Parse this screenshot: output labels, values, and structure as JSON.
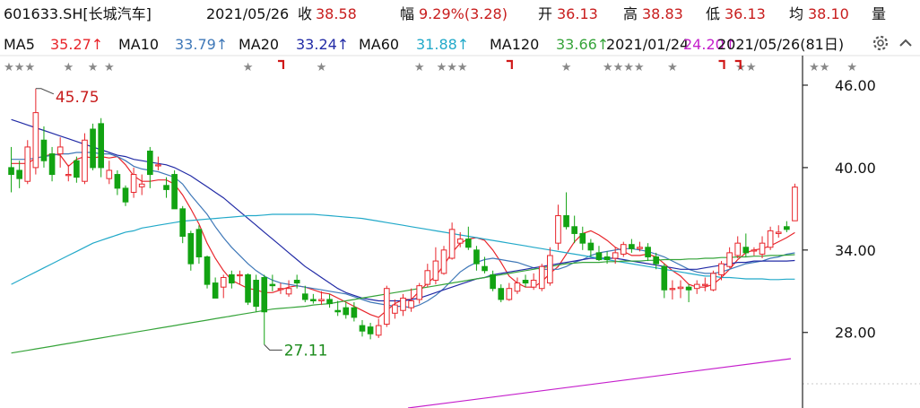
{
  "header": {
    "code_name": "601633.SH[长城汽车]",
    "date": "2021/05/26",
    "close_label": "收",
    "close": "38.58",
    "change_label": "幅",
    "change": "9.29%(3.28)",
    "open_label": "开",
    "open": "36.13",
    "high_label": "高",
    "high": "38.83",
    "low_label": "低",
    "low": "36.13",
    "avg_label": "均",
    "avg": "38.10",
    "volume_label": "量"
  },
  "ma_bar": {
    "items": [
      {
        "label": "MA5",
        "value": "35.27↑",
        "color": "#e8252b"
      },
      {
        "label": "MA10",
        "value": "33.79↑",
        "color": "#3f78b8"
      },
      {
        "label": "MA20",
        "value": "33.24↑",
        "color": "#222ba6"
      },
      {
        "label": "MA60",
        "value": "31.88↑",
        "color": "#22a9c9"
      },
      {
        "label": "MA120",
        "value": "33.66↑",
        "color": "#36a43a"
      },
      {
        "label": "",
        "value": "24.20↑",
        "color": "#c51fcc"
      }
    ],
    "overlap_text": "2021/01/24",
    "range_text": "2021/05/26(81日)",
    "settings_icon": "gear-icon",
    "collapse_icon": "chevron-up-icon"
  },
  "colors": {
    "up": "#e8252b",
    "down": "#12a312",
    "axis": "#222222",
    "grid": "#dddddd"
  },
  "chart_data": {
    "type": "candlestick",
    "ylim": [
      22.5,
      47.5
    ],
    "yticks": [
      "46.00",
      "40.00",
      "34.00",
      "28.00"
    ],
    "ytick_values": [
      46,
      40,
      34,
      28
    ],
    "annotations": [
      {
        "text": "45.75",
        "index": 3,
        "value": 45.75
      },
      {
        "text": "27.11",
        "index": 31,
        "value": 27.11
      }
    ],
    "candles": [
      [
        40,
        39.5,
        41.5,
        38.2
      ],
      [
        39.8,
        39.2,
        40.5,
        38.5
      ],
      [
        39,
        41.5,
        42,
        38.8
      ],
      [
        40,
        44,
        45.75,
        39.5
      ],
      [
        42,
        40.5,
        43,
        40
      ],
      [
        41,
        39.5,
        41.5,
        39
      ],
      [
        41,
        41.5,
        42.2,
        40
      ],
      [
        39.5,
        39.5,
        40.2,
        39
      ],
      [
        40.5,
        39.3,
        40.8,
        38.9
      ],
      [
        39,
        42,
        42.5,
        38.8
      ],
      [
        42.8,
        40,
        43.2,
        39.8
      ],
      [
        43.2,
        40,
        43.6,
        39.3
      ],
      [
        39.2,
        39.8,
        40.5,
        38.8
      ],
      [
        39.5,
        38.5,
        39.8,
        38
      ],
      [
        38.5,
        37.5,
        38.7,
        37.2
      ],
      [
        38.2,
        39.5,
        40,
        37.8
      ],
      [
        38.6,
        38.8,
        39.5,
        38
      ],
      [
        41.2,
        39.5,
        41.5,
        38.5
      ],
      [
        40.2,
        40.2,
        40.8,
        39.8
      ],
      [
        38.7,
        38.4,
        39.3,
        37.8
      ],
      [
        39.5,
        37,
        39.8,
        37
      ],
      [
        37,
        35,
        37.2,
        34.5
      ],
      [
        35.2,
        33,
        35.4,
        32.5
      ],
      [
        35.5,
        33.5,
        35.8,
        33
      ],
      [
        33.5,
        31.5,
        33.6,
        31.2
      ],
      [
        31.6,
        30.5,
        32,
        30.5
      ],
      [
        31.3,
        32,
        32.2,
        30.5
      ],
      [
        32.2,
        31.6,
        32.5,
        31.2
      ],
      [
        32.2,
        32.2,
        32.5,
        31.5
      ],
      [
        32.2,
        30.2,
        32.3,
        30
      ],
      [
        31.8,
        29.9,
        32.2,
        29.5
      ],
      [
        32,
        29.5,
        32.2,
        27.11
      ],
      [
        31.5,
        31.4,
        32.2,
        31
      ],
      [
        31.2,
        31.2,
        31.6,
        30.8
      ],
      [
        30.8,
        31.2,
        31.8,
        30.6
      ],
      [
        31.8,
        31.6,
        32.2,
        31.2
      ],
      [
        30.8,
        30.4,
        31.4,
        30.2
      ],
      [
        30.4,
        30.3,
        30.8,
        30.1
      ],
      [
        30.3,
        30.4,
        31,
        30
      ],
      [
        30.4,
        30.1,
        30.8,
        29.8
      ],
      [
        29.6,
        29.5,
        30.3,
        29.2
      ],
      [
        29.8,
        29.3,
        30.2,
        29
      ],
      [
        29.8,
        29.1,
        30.2,
        28.8
      ],
      [
        28.5,
        28.1,
        28.9,
        27.7
      ],
      [
        28.4,
        27.9,
        28.7,
        27.5
      ],
      [
        27.8,
        28.5,
        29,
        27.6
      ],
      [
        28.6,
        31.2,
        31.4,
        28.4
      ],
      [
        29.4,
        30,
        30.4,
        29
      ],
      [
        29.6,
        30.5,
        30.8,
        29.2
      ],
      [
        29.8,
        30.3,
        31.2,
        29.5
      ],
      [
        30.4,
        31.4,
        31.6,
        30.1
      ],
      [
        31.5,
        32.5,
        33,
        31.3
      ],
      [
        31.8,
        33.2,
        34.2,
        31.5
      ],
      [
        32.3,
        34,
        34.3,
        32.2
      ],
      [
        33.4,
        35.5,
        36,
        33.3
      ],
      [
        34.5,
        34.8,
        35.3,
        34.2
      ],
      [
        34.8,
        34.2,
        35.7,
        34
      ],
      [
        34,
        33,
        34.3,
        32.5
      ],
      [
        32.8,
        32.5,
        33.5,
        32.3
      ],
      [
        32.2,
        31.2,
        32.5,
        31
      ],
      [
        31.2,
        30.4,
        31.5,
        30.2
      ],
      [
        30.4,
        31.2,
        31.6,
        30.3
      ],
      [
        31,
        31.6,
        32,
        30.8
      ],
      [
        31.8,
        31.6,
        32.2,
        31.3
      ],
      [
        31.3,
        31.8,
        32.3,
        31.1
      ],
      [
        31.2,
        32.8,
        33,
        31
      ],
      [
        31.6,
        33.6,
        34.2,
        31.4
      ],
      [
        34.5,
        36.5,
        37.3,
        34
      ],
      [
        36.5,
        35.7,
        38.2,
        35.5
      ],
      [
        35.7,
        35.2,
        36.5,
        34.5
      ],
      [
        35.2,
        34.5,
        35.7,
        34
      ],
      [
        34.5,
        34,
        34.8,
        33.5
      ],
      [
        33.8,
        33.3,
        34.3,
        33.2
      ],
      [
        33.5,
        33.3,
        33.9,
        33
      ],
      [
        33.4,
        33.8,
        34.2,
        33
      ],
      [
        33.7,
        34.4,
        34.6,
        33.5
      ],
      [
        34.4,
        34.1,
        34.8,
        33.8
      ],
      [
        34.1,
        34.2,
        34.6,
        33.9
      ],
      [
        34.2,
        33.5,
        34.5,
        33.2
      ],
      [
        33.5,
        33,
        33.8,
        32.6
      ],
      [
        32.8,
        31.1,
        33,
        30.5
      ],
      [
        31.2,
        31.2,
        31.8,
        30.4
      ],
      [
        31.2,
        31.3,
        31.8,
        30.5
      ],
      [
        31.3,
        31.1,
        31.5,
        30.2
      ],
      [
        31.2,
        31.5,
        31.8,
        30.8
      ],
      [
        31.5,
        31.5,
        32,
        31
      ],
      [
        31.1,
        32.3,
        32.5,
        31
      ],
      [
        32.2,
        33,
        33.2,
        31.8
      ],
      [
        32.8,
        33.8,
        34.2,
        32.7
      ],
      [
        33.6,
        34.5,
        35,
        33.4
      ],
      [
        34.2,
        33.8,
        35.2,
        33.5
      ],
      [
        34,
        34,
        34.2,
        33.6
      ],
      [
        33.7,
        34.5,
        35,
        33.4
      ],
      [
        34.2,
        35.4,
        35.7,
        34
      ],
      [
        35.2,
        35.3,
        35.8,
        34.9
      ],
      [
        35.7,
        35.5,
        36.1,
        35.3
      ],
      [
        36.13,
        38.58,
        38.83,
        36.13
      ]
    ],
    "series": [
      {
        "name": "MA5",
        "color": "#e8252b",
        "values": [
          40.3,
          40.3,
          40.3,
          40.7,
          40.8,
          41,
          40.9,
          40.1,
          40.6,
          40.8,
          40.7,
          40.8,
          40.7,
          40.8,
          40.2,
          39.4,
          39,
          39,
          39.1,
          39.1,
          38.8,
          38,
          37,
          35.9,
          34.5,
          33.4,
          32.5,
          31.8,
          31.5,
          31.2,
          31.1,
          30.9,
          30.9,
          31.1,
          31.3,
          31.4,
          31.3,
          31.1,
          30.9,
          30.8,
          30.5,
          30.2,
          29.9,
          29.6,
          29.3,
          29.1,
          29.6,
          30.1,
          30.4,
          30.4,
          31,
          31.6,
          32.1,
          32.9,
          33.8,
          34.5,
          34.8,
          34.9,
          34.7,
          34,
          33.1,
          32.1,
          31.6,
          31.3,
          31.3,
          31.7,
          32.3,
          32.8,
          33.7,
          34.6,
          35.2,
          35.4,
          35.1,
          34.7,
          34.2,
          33.9,
          33.6,
          33.6,
          33.7,
          33.5,
          33,
          32.5,
          32.1,
          31.5,
          31.3,
          31.3,
          31.5,
          32,
          32.6,
          33.3,
          33.8,
          34,
          34.1,
          34.3,
          34.6,
          34.9,
          35.27
        ]
      },
      {
        "name": "MA10",
        "color": "#3f78b8",
        "values": [
          40.6,
          40.6,
          40.6,
          40.7,
          40.8,
          40.9,
          41,
          41,
          41.1,
          41.1,
          41.1,
          41,
          41,
          40.8,
          40.5,
          40.1,
          39.9,
          39.8,
          39.7,
          39.5,
          39.3,
          38.8,
          38,
          37.3,
          36.6,
          35.7,
          34.9,
          34.2,
          33.6,
          33,
          32.5,
          32.1,
          31.8,
          31.6,
          31.5,
          31.4,
          31.3,
          31.2,
          31.1,
          31,
          30.9,
          30.8,
          30.6,
          30.4,
          30.2,
          30.1,
          30,
          29.9,
          29.9,
          29.8,
          30,
          30.3,
          30.7,
          31.2,
          31.8,
          32.4,
          32.8,
          33.1,
          33.3,
          33.4,
          33.3,
          33.2,
          33.1,
          32.9,
          32.7,
          32.6,
          32.6,
          32.6,
          32.8,
          33.1,
          33.3,
          33.6,
          33.8,
          33.9,
          34,
          34.1,
          34.1,
          34,
          33.9,
          33.7,
          33.5,
          33.2,
          32.9,
          32.6,
          32.4,
          32.3,
          32.3,
          32.4,
          32.6,
          32.8,
          33,
          33.1,
          33.2,
          33.4,
          33.5,
          33.7,
          33.79
        ]
      },
      {
        "name": "MA20",
        "color": "#222ba6",
        "values": [
          43.5,
          43.3,
          43.1,
          42.9,
          42.7,
          42.5,
          42.3,
          42.1,
          41.9,
          41.7,
          41.5,
          41.3,
          41.1,
          40.9,
          40.8,
          40.6,
          40.5,
          40.4,
          40.3,
          40.2,
          40,
          39.7,
          39.4,
          39,
          38.6,
          38.2,
          37.8,
          37.3,
          36.8,
          36.3,
          35.8,
          35.3,
          34.8,
          34.3,
          33.8,
          33.3,
          32.8,
          32.4,
          32,
          31.6,
          31.2,
          30.9,
          30.7,
          30.5,
          30.4,
          30.3,
          30.3,
          30.3,
          30.3,
          30.4,
          30.5,
          30.7,
          30.9,
          31.1,
          31.3,
          31.5,
          31.7,
          31.9,
          32,
          32.2,
          32.3,
          32.4,
          32.5,
          32.6,
          32.7,
          32.8,
          32.9,
          33,
          33.1,
          33.2,
          33.3,
          33.4,
          33.4,
          33.4,
          33.4,
          33.3,
          33.2,
          33.1,
          33,
          32.9,
          32.8,
          32.7,
          32.6,
          32.6,
          32.6,
          32.7,
          32.8,
          32.9,
          33,
          33.1,
          33.1,
          33.2,
          33.2,
          33.2,
          33.2,
          33.2,
          33.24
        ]
      },
      {
        "name": "MA60",
        "color": "#22a9c9",
        "values": [
          31.5,
          31.8,
          32.1,
          32.4,
          32.7,
          33,
          33.3,
          33.6,
          33.9,
          34.2,
          34.5,
          34.7,
          34.9,
          35.1,
          35.3,
          35.4,
          35.6,
          35.7,
          35.8,
          35.9,
          36,
          36.1,
          36.15,
          36.2,
          36.25,
          36.3,
          36.35,
          36.4,
          36.45,
          36.5,
          36.5,
          36.55,
          36.6,
          36.6,
          36.6,
          36.6,
          36.6,
          36.6,
          36.55,
          36.5,
          36.45,
          36.4,
          36.35,
          36.3,
          36.2,
          36.1,
          36,
          35.9,
          35.8,
          35.7,
          35.6,
          35.5,
          35.4,
          35.3,
          35.2,
          35.1,
          35,
          34.9,
          34.8,
          34.7,
          34.6,
          34.5,
          34.4,
          34.3,
          34.2,
          34.1,
          34,
          33.9,
          33.8,
          33.7,
          33.6,
          33.5,
          33.4,
          33.3,
          33.2,
          33.1,
          33,
          32.9,
          32.8,
          32.7,
          32.6,
          32.5,
          32.4,
          32.3,
          32.2,
          32.1,
          32.1,
          32,
          32,
          31.95,
          31.9,
          31.9,
          31.9,
          31.85,
          31.85,
          31.88,
          31.88
        ]
      },
      {
        "name": "MA120",
        "color": "#36a43a",
        "values": [
          26.5,
          26.6,
          26.7,
          26.8,
          26.9,
          27,
          27.1,
          27.2,
          27.3,
          27.4,
          27.5,
          27.6,
          27.7,
          27.8,
          27.9,
          28,
          28.1,
          28.2,
          28.3,
          28.4,
          28.5,
          28.6,
          28.7,
          28.8,
          28.9,
          29,
          29.1,
          29.2,
          29.3,
          29.4,
          29.5,
          29.6,
          29.7,
          29.75,
          29.8,
          29.85,
          29.9,
          30,
          30.05,
          30.1,
          30.2,
          30.3,
          30.4,
          30.5,
          30.6,
          30.7,
          30.8,
          30.9,
          31,
          31.1,
          31.2,
          31.3,
          31.4,
          31.5,
          31.6,
          31.7,
          31.8,
          31.9,
          32,
          32.1,
          32.2,
          32.3,
          32.4,
          32.5,
          32.6,
          32.7,
          32.8,
          32.9,
          33,
          33.05,
          33.1,
          33.1,
          33.1,
          33.15,
          33.15,
          33.2,
          33.2,
          33.2,
          33.25,
          33.25,
          33.3,
          33.3,
          33.3,
          33.35,
          33.35,
          33.4,
          33.4,
          33.45,
          33.45,
          33.5,
          33.5,
          33.55,
          33.55,
          33.6,
          33.6,
          33.63,
          33.66
        ]
      },
      {
        "name": "",
        "color": "#c51fcc",
        "values": [
          null,
          null,
          null,
          null,
          null,
          null,
          null,
          null,
          null,
          null,
          null,
          null,
          null,
          null,
          null,
          null,
          null,
          null,
          null,
          null,
          null,
          null,
          null,
          null,
          null,
          null,
          null,
          null,
          null,
          null,
          null,
          null,
          null,
          null,
          null,
          null,
          null,
          null,
          null,
          null,
          null,
          null,
          null,
          null,
          null,
          null,
          null,
          null,
          null,
          null,
          null,
          null,
          null,
          null,
          null,
          null,
          null,
          null,
          null,
          null,
          null,
          null,
          null,
          null,
          null,
          null,
          null,
          null,
          null,
          null,
          null,
          null,
          null,
          null,
          null,
          null,
          null,
          null,
          null,
          null,
          null,
          null,
          null,
          null,
          null,
          null,
          null,
          null,
          null,
          null,
          null,
          null,
          null,
          null,
          null,
          null,
          null
        ]
      }
    ],
    "star_marks": [
      {
        "text": "★★★",
        "index": 1
      },
      {
        "text": "★",
        "index": 7
      },
      {
        "text": "★",
        "index": 10
      },
      {
        "text": "★",
        "index": 12
      },
      {
        "text": "★",
        "index": 29
      },
      {
        "text": "★",
        "index": 38
      },
      {
        "text": "★",
        "index": 50
      },
      {
        "text": "★★★",
        "index": 54
      },
      {
        "text": "★",
        "index": 68
      },
      {
        "text": "★★★★",
        "index": 75
      },
      {
        "text": "★",
        "index": 81
      },
      {
        "text": "★★",
        "index": 90
      },
      {
        "text": "★★",
        "index": 99
      },
      {
        "text": "★",
        "index": 103
      }
    ],
    "flag_marks": [
      33,
      61,
      87,
      89
    ]
  }
}
